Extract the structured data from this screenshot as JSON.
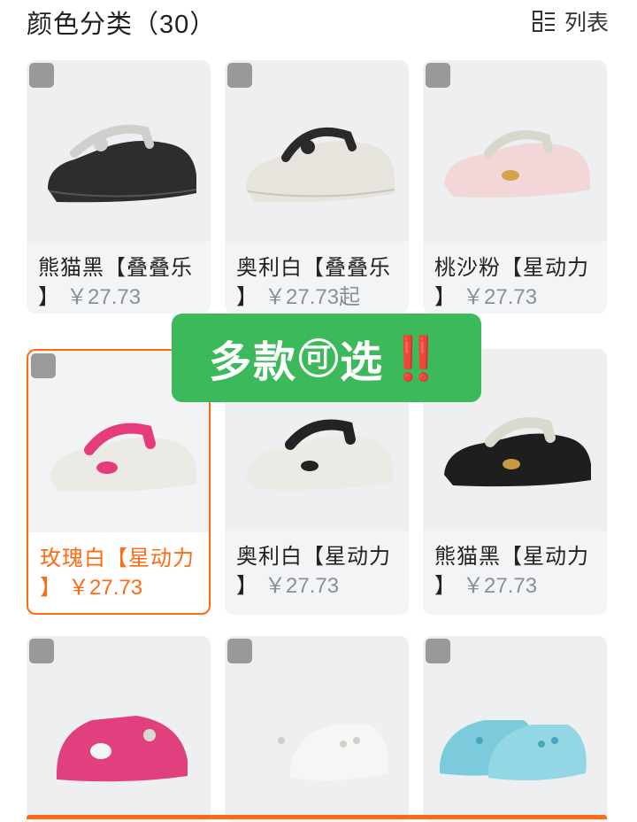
{
  "header": {
    "title": "颜色分类（30）",
    "view_toggle_label": "列表"
  },
  "colors": {
    "accent": "#ff6a13",
    "banner": "#3cb95a"
  },
  "cards": [
    {
      "name": "熊猫黑【叠叠乐",
      "bracket": "】",
      "price": "￥27.73",
      "shoe": "black-clog"
    },
    {
      "name": "奥利白【叠叠乐",
      "bracket": "】",
      "price": "￥27.73起",
      "shoe": "white-black-strap-clog"
    },
    {
      "name": "桃沙粉【星动力",
      "bracket": "】",
      "price": "￥27.73",
      "shoe": "pink-clog"
    },
    {
      "name": "玫瑰白【星动力",
      "bracket": "】",
      "price": "￥27.73",
      "shoe": "white-pink-strap-clog",
      "selected": true
    },
    {
      "name": "奥利白【星动力",
      "bracket": "】",
      "price": "￥27.73",
      "shoe": "white-black-strap-clog"
    },
    {
      "name": "熊猫黑【星动力",
      "bracket": "】",
      "price": "￥27.73",
      "shoe": "black-clog"
    },
    {
      "name": "",
      "bracket": "",
      "price": "",
      "shoe": "pink-clog"
    },
    {
      "name": "",
      "bracket": "",
      "price": "",
      "shoe": "white-pair"
    },
    {
      "name": "",
      "bracket": "",
      "price": "",
      "shoe": "blue-pair"
    }
  ],
  "banner": {
    "text_a": "多款",
    "text_circled": "可",
    "text_b": "选",
    "bang": "‼️"
  }
}
